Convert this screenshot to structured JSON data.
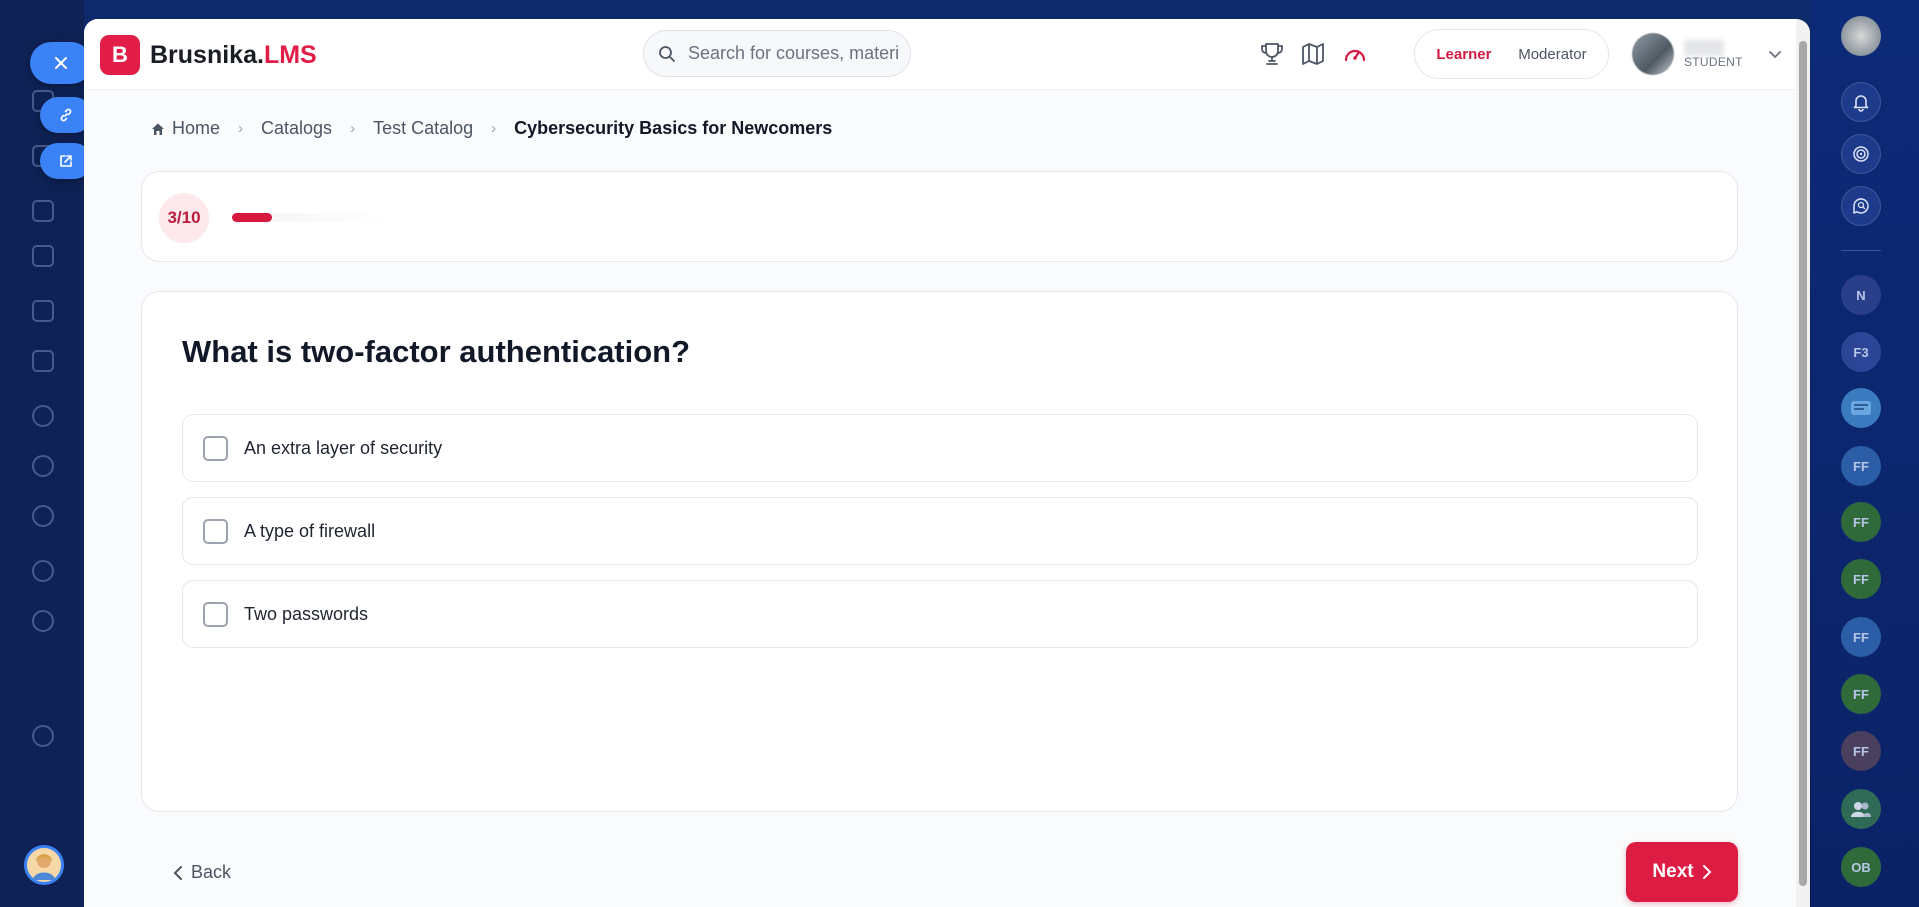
{
  "app": {
    "logo_letter": "B",
    "brand_main": "Brusnika.",
    "brand_accent": "LMS"
  },
  "search": {
    "placeholder": "Search for courses, materi"
  },
  "header_icons": [
    "trophy-icon",
    "map-icon",
    "speedometer-icon"
  ],
  "roles": {
    "learner": "Learner",
    "moderator": "Moderator",
    "active": "Learner"
  },
  "user": {
    "role": "STUDENT"
  },
  "breadcrumb": {
    "home": "Home",
    "catalogs": "Catalogs",
    "test_catalog": "Test Catalog",
    "current": "Cybersecurity Basics for Newcomers"
  },
  "progress": {
    "label": "3/10",
    "fraction": 0.25
  },
  "question": {
    "title": "What is two-factor authentication?",
    "options": [
      {
        "label": "An extra layer of security",
        "checked": false
      },
      {
        "label": "A type of firewall",
        "checked": false
      },
      {
        "label": "Two passwords",
        "checked": false
      }
    ]
  },
  "nav": {
    "back": "Back",
    "next": "Next"
  },
  "right_rail": {
    "items": [
      "N",
      "F3",
      "FF",
      "FF",
      "FF",
      "FF",
      "FF",
      "FF",
      "OB"
    ]
  },
  "colors": {
    "brand": "#e11d48",
    "next_button": "#dc1c43",
    "background": "#0c2160"
  }
}
